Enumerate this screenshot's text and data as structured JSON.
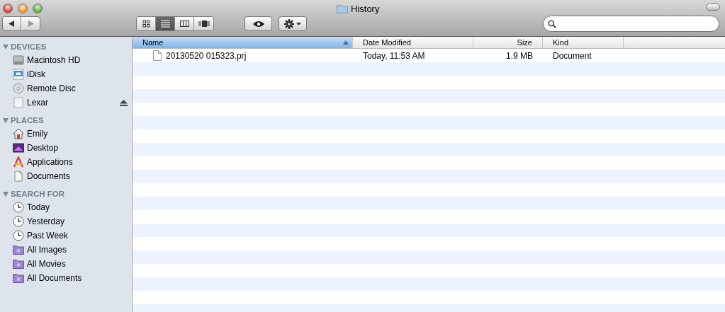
{
  "window": {
    "title": "History"
  },
  "toolbar": {
    "view_buttons": [
      {
        "kind": "icon",
        "selected": false
      },
      {
        "kind": "list",
        "selected": true
      },
      {
        "kind": "column",
        "selected": false
      },
      {
        "kind": "coverflow",
        "selected": false
      }
    ]
  },
  "sidebar": {
    "sections": [
      {
        "title": "DEVICES",
        "expanded": true,
        "items": [
          {
            "label": "Macintosh HD",
            "kind": "harddisk",
            "ejectable": false
          },
          {
            "label": "iDisk",
            "kind": "idisk",
            "ejectable": false
          },
          {
            "label": "Remote Disc",
            "kind": "disc",
            "ejectable": false
          },
          {
            "label": "Lexar",
            "kind": "drive",
            "ejectable": true
          }
        ]
      },
      {
        "title": "PLACES",
        "expanded": true,
        "items": [
          {
            "label": "Emily",
            "kind": "home",
            "ejectable": false
          },
          {
            "label": "Desktop",
            "kind": "desktop",
            "ejectable": false
          },
          {
            "label": "Applications",
            "kind": "apps",
            "ejectable": false
          },
          {
            "label": "Documents",
            "kind": "document",
            "ejectable": false
          }
        ]
      },
      {
        "title": "SEARCH FOR",
        "expanded": true,
        "items": [
          {
            "label": "Today",
            "kind": "clock",
            "ejectable": false
          },
          {
            "label": "Yesterday",
            "kind": "clock",
            "ejectable": false
          },
          {
            "label": "Past Week",
            "kind": "clock",
            "ejectable": false
          },
          {
            "label": "All Images",
            "kind": "smartfolder",
            "ejectable": false
          },
          {
            "label": "All Movies",
            "kind": "smartfolder",
            "ejectable": false
          },
          {
            "label": "All Documents",
            "kind": "smartfolder",
            "ejectable": false
          }
        ]
      }
    ]
  },
  "table": {
    "columns": [
      {
        "label": "Name",
        "selected": true
      },
      {
        "label": "Date Modified",
        "selected": false
      },
      {
        "label": "Size",
        "selected": false
      },
      {
        "label": "Kind",
        "selected": false
      }
    ],
    "rows": [
      {
        "name": "20130520 015323.prj",
        "date_modified": "Today, 11:53 AM",
        "size": "1.9 MB",
        "kind": "Document"
      }
    ]
  }
}
